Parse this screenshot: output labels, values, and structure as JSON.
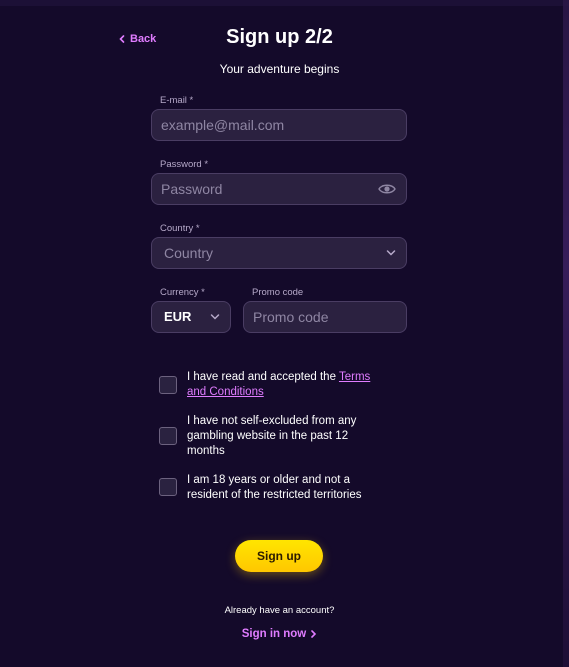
{
  "header": {
    "back_label": "Back",
    "title": "Sign up 2/2",
    "subtitle": "Your adventure begins"
  },
  "form": {
    "email_label": "E-mail *",
    "email_placeholder": "example@mail.com",
    "password_label": "Password *",
    "password_placeholder": "Password",
    "country_label": "Country *",
    "country_placeholder": "Country",
    "currency_label": "Currency *",
    "currency_value": "EUR",
    "promo_label": "Promo code",
    "promo_placeholder": "Promo code"
  },
  "checks": [
    {
      "text": "I have read and accepted the ",
      "link": "Terms and Conditions"
    },
    {
      "text": "I have not self-excluded from any gambling website in the past 12 months"
    },
    {
      "text": "I am 18 years or older and not a resident of the restricted territories"
    }
  ],
  "footer": {
    "signup_label": "Sign up",
    "already_text": "Already have an account?",
    "signin_label": "Sign in now"
  },
  "colors": {
    "background": "#140a2a",
    "accent_pink": "#e07cff",
    "button_yellow": "#ffd600"
  },
  "icons": [
    "chevron-left-icon",
    "eye-icon",
    "chevron-down-icon",
    "chevron-right-icon"
  ]
}
